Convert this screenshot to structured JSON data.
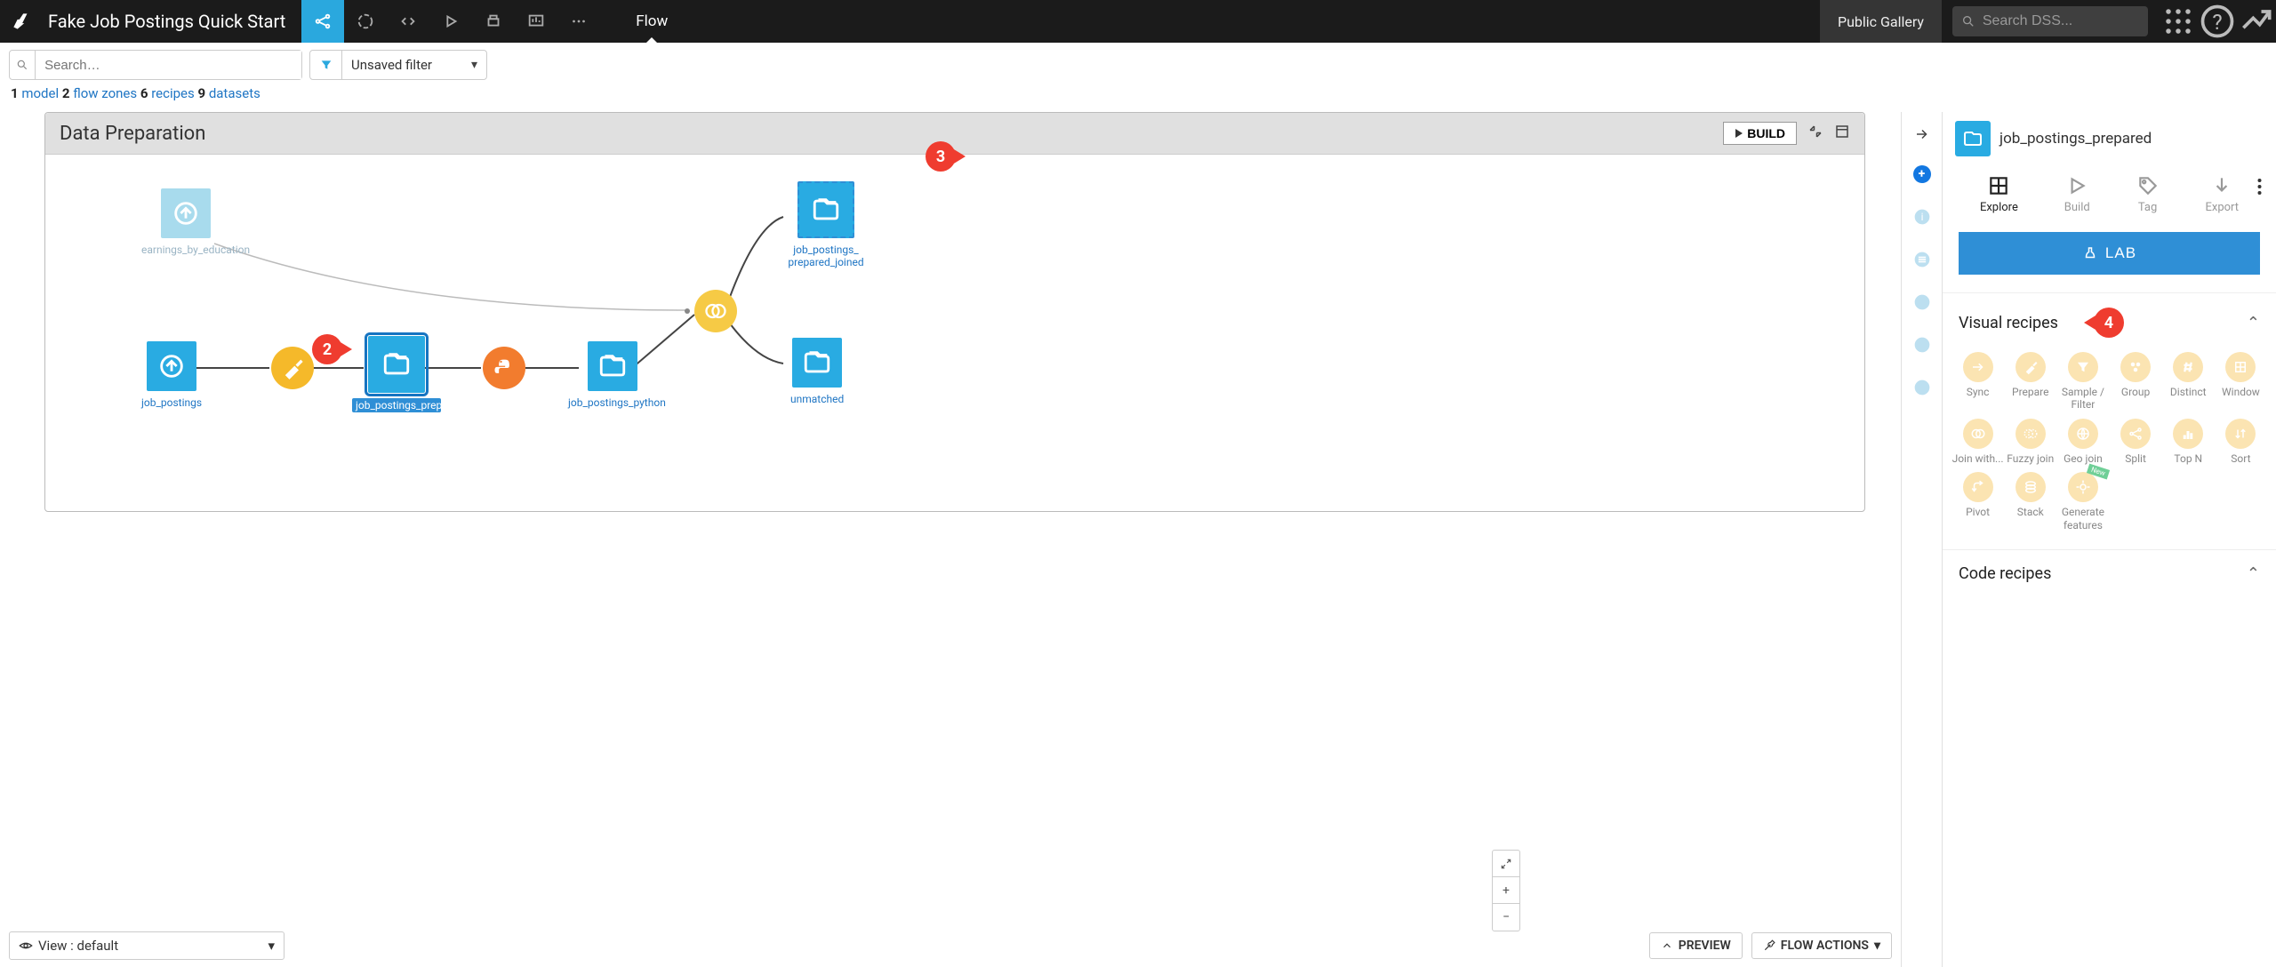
{
  "topbar": {
    "project_title": "Fake Job Postings Quick Start",
    "flow_label": "Flow",
    "public_gallery": "Public Gallery",
    "search_placeholder": "Search DSS..."
  },
  "filterbar": {
    "search_placeholder": "Search…",
    "filter_label": "Unsaved filter"
  },
  "counts": {
    "model_n": "1",
    "model_label": "model",
    "zones_n": "2",
    "zones_label": "flow zones",
    "recipes_n": "6",
    "recipes_label": "recipes",
    "datasets_n": "9",
    "datasets_label": "datasets"
  },
  "zone": {
    "title": "Data Preparation",
    "build_btn": "BUILD"
  },
  "nodes": {
    "earnings_label": "earnings_by_education",
    "job_postings_label": "job_postings",
    "job_postings_prepared_label": "job_postings_prepared",
    "job_postings_python_label": "job_postings_python",
    "job_postings_prepared_joined_l1": "job_postings_",
    "job_postings_prepared_joined_l2": "prepared_joined",
    "unmatched_label": "unmatched"
  },
  "right_panel": {
    "dataset_name": "job_postings_prepared",
    "actions": {
      "explore": "Explore",
      "build": "Build",
      "tag": "Tag",
      "export": "Export"
    },
    "lab_btn": "LAB",
    "visual_recipes_header": "Visual recipes",
    "code_recipes_header": "Code recipes",
    "recipes": {
      "sync": "Sync",
      "prepare": "Prepare",
      "sample_filter": "Sample / Filter",
      "group": "Group",
      "distinct": "Distinct",
      "window": "Window",
      "join": "Join with...",
      "fuzzy": "Fuzzy join",
      "geo": "Geo join",
      "split": "Split",
      "topn": "Top N",
      "sort": "Sort",
      "pivot": "Pivot",
      "stack": "Stack",
      "genfeat": "Generate features",
      "new_badge": "New"
    }
  },
  "bottom": {
    "view_label": "View : default",
    "preview": "PREVIEW",
    "flow_actions": "FLOW ACTIONS"
  },
  "callouts": {
    "c2": "2",
    "c3": "3",
    "c4": "4"
  }
}
